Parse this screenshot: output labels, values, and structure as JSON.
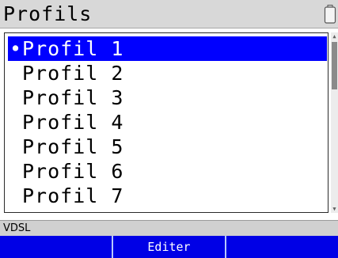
{
  "header": {
    "title": "Profils",
    "battery_icon": "battery-icon"
  },
  "list": {
    "items": [
      {
        "label": "•Profil 1",
        "selected": true
      },
      {
        "label": "Profil 2",
        "selected": false
      },
      {
        "label": "Profil 3",
        "selected": false
      },
      {
        "label": "Profil 4",
        "selected": false
      },
      {
        "label": "Profil 5",
        "selected": false
      },
      {
        "label": "Profil 6",
        "selected": false
      },
      {
        "label": "Profil 7",
        "selected": false
      }
    ]
  },
  "status": {
    "text": "VDSL"
  },
  "softkeys": {
    "left": "",
    "center": "Editer",
    "right": ""
  },
  "colors": {
    "selection": "#0000ff",
    "softkey_bg": "#0000e6",
    "titlebar_bg": "#d8d8d8"
  }
}
